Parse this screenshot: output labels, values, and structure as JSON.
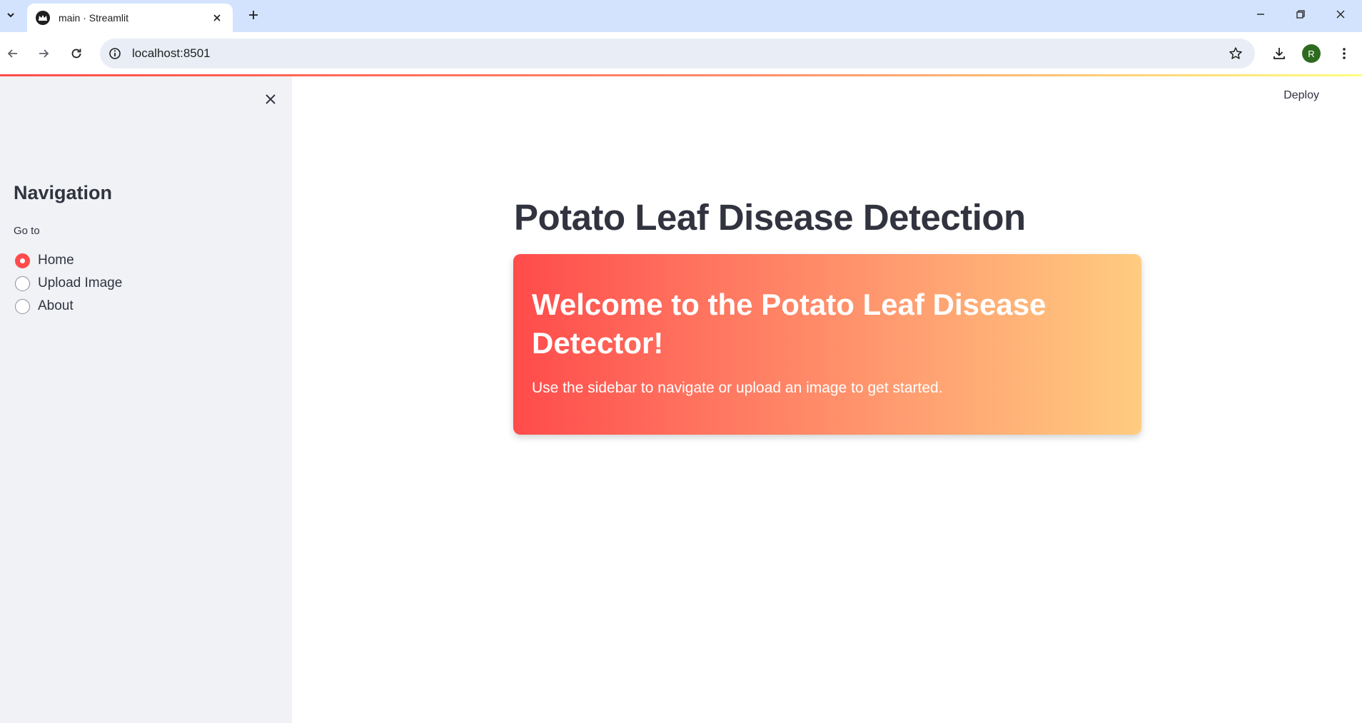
{
  "browser": {
    "tab_title": "main · Streamlit",
    "url": "localhost:8501",
    "profile_initial": "R"
  },
  "app": {
    "deploy_label": "Deploy",
    "sidebar": {
      "heading": "Navigation",
      "radio_label": "Go to",
      "options": [
        {
          "label": "Home",
          "selected": true
        },
        {
          "label": "Upload Image",
          "selected": false
        },
        {
          "label": "About",
          "selected": false
        }
      ]
    },
    "main": {
      "title": "Potato Leaf Disease Detection",
      "hero_title": "Welcome to the Potato Leaf Disease Detector!",
      "hero_text": "Use the sidebar to navigate or upload an image to get started."
    }
  },
  "colors": {
    "primary": "#ff4b4b",
    "sidebar_bg": "#f0f2f6",
    "text": "#31333f",
    "gradient_end": "#ffcc80"
  },
  "icons": {
    "tab_search": "chevron-down-icon",
    "favicon": "streamlit-crown-icon",
    "tab_close": "close-icon",
    "new_tab": "plus-icon",
    "back": "arrow-left-icon",
    "forward": "arrow-right-icon",
    "reload": "reload-icon",
    "site_info": "info-icon",
    "bookmark": "star-icon",
    "download": "download-icon",
    "menu": "kebab-menu-icon",
    "sidebar_close": "close-icon"
  }
}
